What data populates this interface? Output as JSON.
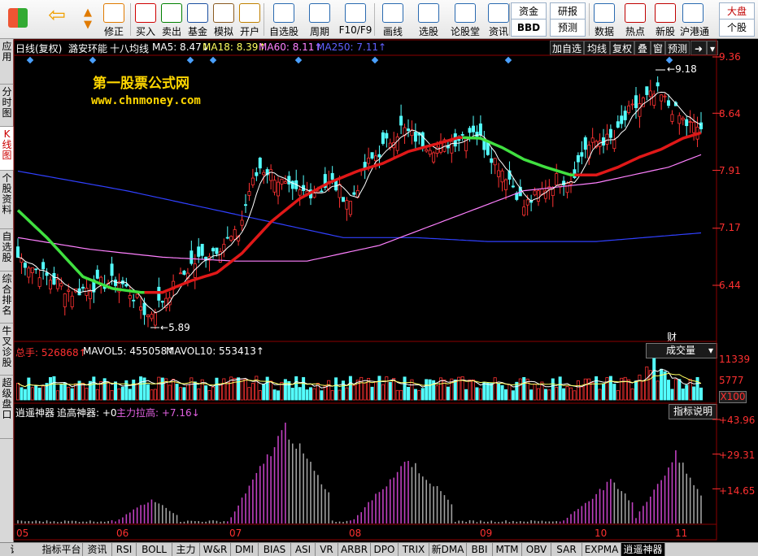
{
  "toolbar": {
    "buttons": [
      {
        "label": "修正",
        "icon": "refresh-icon",
        "color": "#e07a00"
      },
      {
        "label": "买入",
        "icon": "buy-icon",
        "color": "#d00000"
      },
      {
        "label": "卖出",
        "icon": "sell-icon",
        "color": "#008000"
      },
      {
        "label": "基金",
        "icon": "fund-icon",
        "color": "#1a4fa0"
      },
      {
        "label": "模拟",
        "icon": "gavel-icon",
        "color": "#8a5a20"
      },
      {
        "label": "开户",
        "icon": "lock-icon",
        "color": "#c08000"
      },
      {
        "label": "自选股",
        "icon": "watchlist-icon",
        "color": "#2a6ab0"
      },
      {
        "label": "周期",
        "icon": "clock-icon",
        "color": "#2a6ab0"
      },
      {
        "label": "F10/F9",
        "icon": "f10-icon",
        "color": "#2a6ab0"
      },
      {
        "label": "画线",
        "icon": "pen-icon",
        "color": "#2a6ab0"
      },
      {
        "label": "选股",
        "icon": "screener-icon",
        "color": "#2a6ab0"
      },
      {
        "label": "论股堂",
        "icon": "forum-icon",
        "color": "#2a6ab0"
      },
      {
        "label": "资讯",
        "icon": "news-icon",
        "color": "#2a6ab0"
      },
      {
        "label": "数据",
        "icon": "pe-icon",
        "color": "#2a6ab0"
      },
      {
        "label": "热点",
        "icon": "hot-icon",
        "color": "#c00000"
      },
      {
        "label": "新股",
        "icon": "newstock-icon",
        "color": "#c00000"
      },
      {
        "label": "沪港通",
        "icon": "sse-hkex-icon",
        "color": "#2a6ab0"
      }
    ],
    "fund_box": [
      "资金",
      "BBD"
    ],
    "research_box": [
      "研报",
      "预测"
    ],
    "market_box": [
      "大盘",
      "个股"
    ],
    "icon_glyphs": {
      "back": "⇦",
      "pe": "PE",
      "sse": "SSE"
    }
  },
  "sidebar": {
    "items": [
      {
        "label": "应用",
        "active": false
      },
      {
        "label": "分时图",
        "active": false
      },
      {
        "label": "K线图",
        "active": true
      },
      {
        "label": "个股资料",
        "active": false
      },
      {
        "label": "自选股",
        "active": false
      },
      {
        "label": "综合排名",
        "active": false
      },
      {
        "label": "牛叉诊股",
        "active": false
      },
      {
        "label": "超级盘口",
        "active": false
      }
    ]
  },
  "main": {
    "header": {
      "period": "日线(复权)",
      "stock_name": "潞安环能",
      "ma_label": "十八均线",
      "ma5": "MA5: 8.47↓",
      "ma18": "MA18: 8.39↑",
      "ma60": "MA60: 8.11↑",
      "ma250": "MA250: 7.11↑"
    },
    "right_buttons": [
      "加自选",
      "均线",
      "复权",
      "叠",
      "窗",
      "预测"
    ],
    "watermark_title": "第一股票公式网",
    "watermark_url": "www.chnmoney.com",
    "price_ticks": [
      "9.36",
      "8.64",
      "7.91",
      "7.17",
      "6.44"
    ],
    "high_label": "9.18",
    "low_label": "5.89",
    "cai_label": "财"
  },
  "volume": {
    "total": "总手: 526868↑",
    "mavol5": "MAVOL5: 455058↑",
    "mavol10": "MAVOL10: 553413↑",
    "dropdown": "成交量",
    "ticks": [
      "11339",
      "5777"
    ],
    "scale": "X100"
  },
  "indicator": {
    "name": "逍遥神器",
    "line1": "追高神器: +0",
    "line2": "主力拉高: +7.16↓",
    "explain_button": "指标说明",
    "ticks": [
      "+43.96",
      "+29.31",
      "+14.65"
    ]
  },
  "date_axis": [
    "05",
    "06",
    "07",
    "08",
    "09",
    "10",
    "11"
  ],
  "bottom_tabs": [
    "设置",
    "指标平台",
    "资讯",
    "RSI",
    "BOLL",
    "主力",
    "W&R",
    "DMI",
    "BIAS",
    "ASI",
    "VR",
    "ARBR",
    "DPO",
    "TRIX",
    "新DMA",
    "BBI",
    "MTM",
    "OBV",
    "SAR",
    "EXPMA",
    "逍遥神器"
  ],
  "active_tab": "逍遥神器",
  "colors": {
    "up": "#ff3232",
    "down": "#54ffff",
    "ma5": "#ffffff",
    "ma18_up": "#e01818",
    "ma18_down": "#40e040",
    "ma60": "#ff80ff",
    "ma250": "#3040ff",
    "grid": "#8b0000",
    "watermark": "#ffd700",
    "indicator_purple": "#c040c0",
    "indicator_gray": "#a0a0a0"
  },
  "chart_data": [
    {
      "type": "candlestick",
      "title": "潞安环能 日线(复权)",
      "x_months": [
        "05",
        "06",
        "07",
        "08",
        "09",
        "10",
        "11"
      ],
      "ylim": [
        5.85,
        9.4
      ],
      "price_ticks": [
        9.36,
        8.64,
        7.91,
        7.17,
        6.44
      ],
      "anchors_close": [
        [
          0,
          6.8
        ],
        [
          8,
          6.55
        ],
        [
          15,
          6.35
        ],
        [
          22,
          6.45
        ],
        [
          28,
          6.5
        ],
        [
          32,
          6.3
        ],
        [
          36,
          6.05
        ],
        [
          41,
          6.3
        ],
        [
          48,
          6.7
        ],
        [
          56,
          6.95
        ],
        [
          61,
          7.1
        ],
        [
          64,
          7.65
        ],
        [
          67,
          7.95
        ],
        [
          71,
          7.85
        ],
        [
          76,
          7.6
        ],
        [
          82,
          7.65
        ],
        [
          87,
          7.75
        ],
        [
          92,
          7.5
        ],
        [
          96,
          7.95
        ],
        [
          101,
          8.2
        ],
        [
          106,
          8.45
        ],
        [
          111,
          8.3
        ],
        [
          116,
          8.2
        ],
        [
          121,
          8.3
        ],
        [
          126,
          8.45
        ],
        [
          131,
          8.1
        ],
        [
          136,
          7.8
        ],
        [
          140,
          7.45
        ],
        [
          145,
          7.65
        ],
        [
          149,
          7.8
        ],
        [
          153,
          7.8
        ],
        [
          157,
          8.2
        ],
        [
          161,
          8.3
        ],
        [
          165,
          8.3
        ],
        [
          169,
          8.65
        ],
        [
          173,
          8.8
        ],
        [
          177,
          8.9
        ],
        [
          181,
          8.7
        ],
        [
          185,
          8.5
        ],
        [
          189,
          8.45
        ]
      ],
      "anchors_ma18": [
        [
          0,
          7.4
        ],
        [
          8,
          7.05
        ],
        [
          18,
          6.55
        ],
        [
          26,
          6.4
        ],
        [
          34,
          6.35
        ],
        [
          40,
          6.35
        ],
        [
          48,
          6.5
        ],
        [
          55,
          6.6
        ],
        [
          62,
          6.85
        ],
        [
          70,
          7.25
        ],
        [
          78,
          7.55
        ],
        [
          86,
          7.75
        ],
        [
          94,
          7.9
        ],
        [
          101,
          8.0
        ],
        [
          108,
          8.15
        ],
        [
          116,
          8.25
        ],
        [
          122,
          8.33
        ],
        [
          128,
          8.32
        ],
        [
          134,
          8.2
        ],
        [
          140,
          8.05
        ],
        [
          146,
          7.95
        ],
        [
          153,
          7.85
        ],
        [
          160,
          7.85
        ],
        [
          166,
          7.95
        ],
        [
          172,
          8.08
        ],
        [
          178,
          8.18
        ],
        [
          184,
          8.32
        ],
        [
          189,
          8.39
        ]
      ],
      "anchors_ma60": [
        [
          0,
          7.05
        ],
        [
          20,
          6.9
        ],
        [
          40,
          6.8
        ],
        [
          60,
          6.75
        ],
        [
          80,
          6.75
        ],
        [
          100,
          6.95
        ],
        [
          120,
          7.3
        ],
        [
          140,
          7.65
        ],
        [
          160,
          7.75
        ],
        [
          180,
          7.95
        ],
        [
          189,
          8.11
        ]
      ],
      "anchors_ma250": [
        [
          0,
          7.9
        ],
        [
          30,
          7.65
        ],
        [
          60,
          7.35
        ],
        [
          90,
          7.05
        ],
        [
          110,
          7.05
        ],
        [
          130,
          7.0
        ],
        [
          160,
          7.0
        ],
        [
          189,
          7.11
        ]
      ],
      "high": 9.18,
      "low": 5.89,
      "count": 190
    },
    {
      "type": "bar",
      "title": "成交量",
      "ylim": [
        0,
        11339
      ],
      "ticks": [
        11339,
        5777
      ],
      "scale": "X100",
      "avg": 4500
    },
    {
      "type": "bar",
      "title": "逍遥神器",
      "ylim": [
        0,
        43.96
      ],
      "ticks": [
        43.96,
        29.31,
        14.65
      ],
      "waves": [
        {
          "start": 26,
          "peak": 37,
          "end": 44,
          "max": 11,
          "color": "purple"
        },
        {
          "start": 58,
          "peak": 74,
          "end": 86,
          "max": 43.96,
          "color": "purple"
        },
        {
          "start": 92,
          "peak": 108,
          "end": 120,
          "max": 29.31,
          "color": "purple"
        },
        {
          "start": 150,
          "peak": 164,
          "end": 170,
          "max": 19,
          "color": "purple"
        },
        {
          "start": 170,
          "peak": 182,
          "end": 189,
          "max": 31,
          "color": "purple"
        }
      ]
    }
  ]
}
